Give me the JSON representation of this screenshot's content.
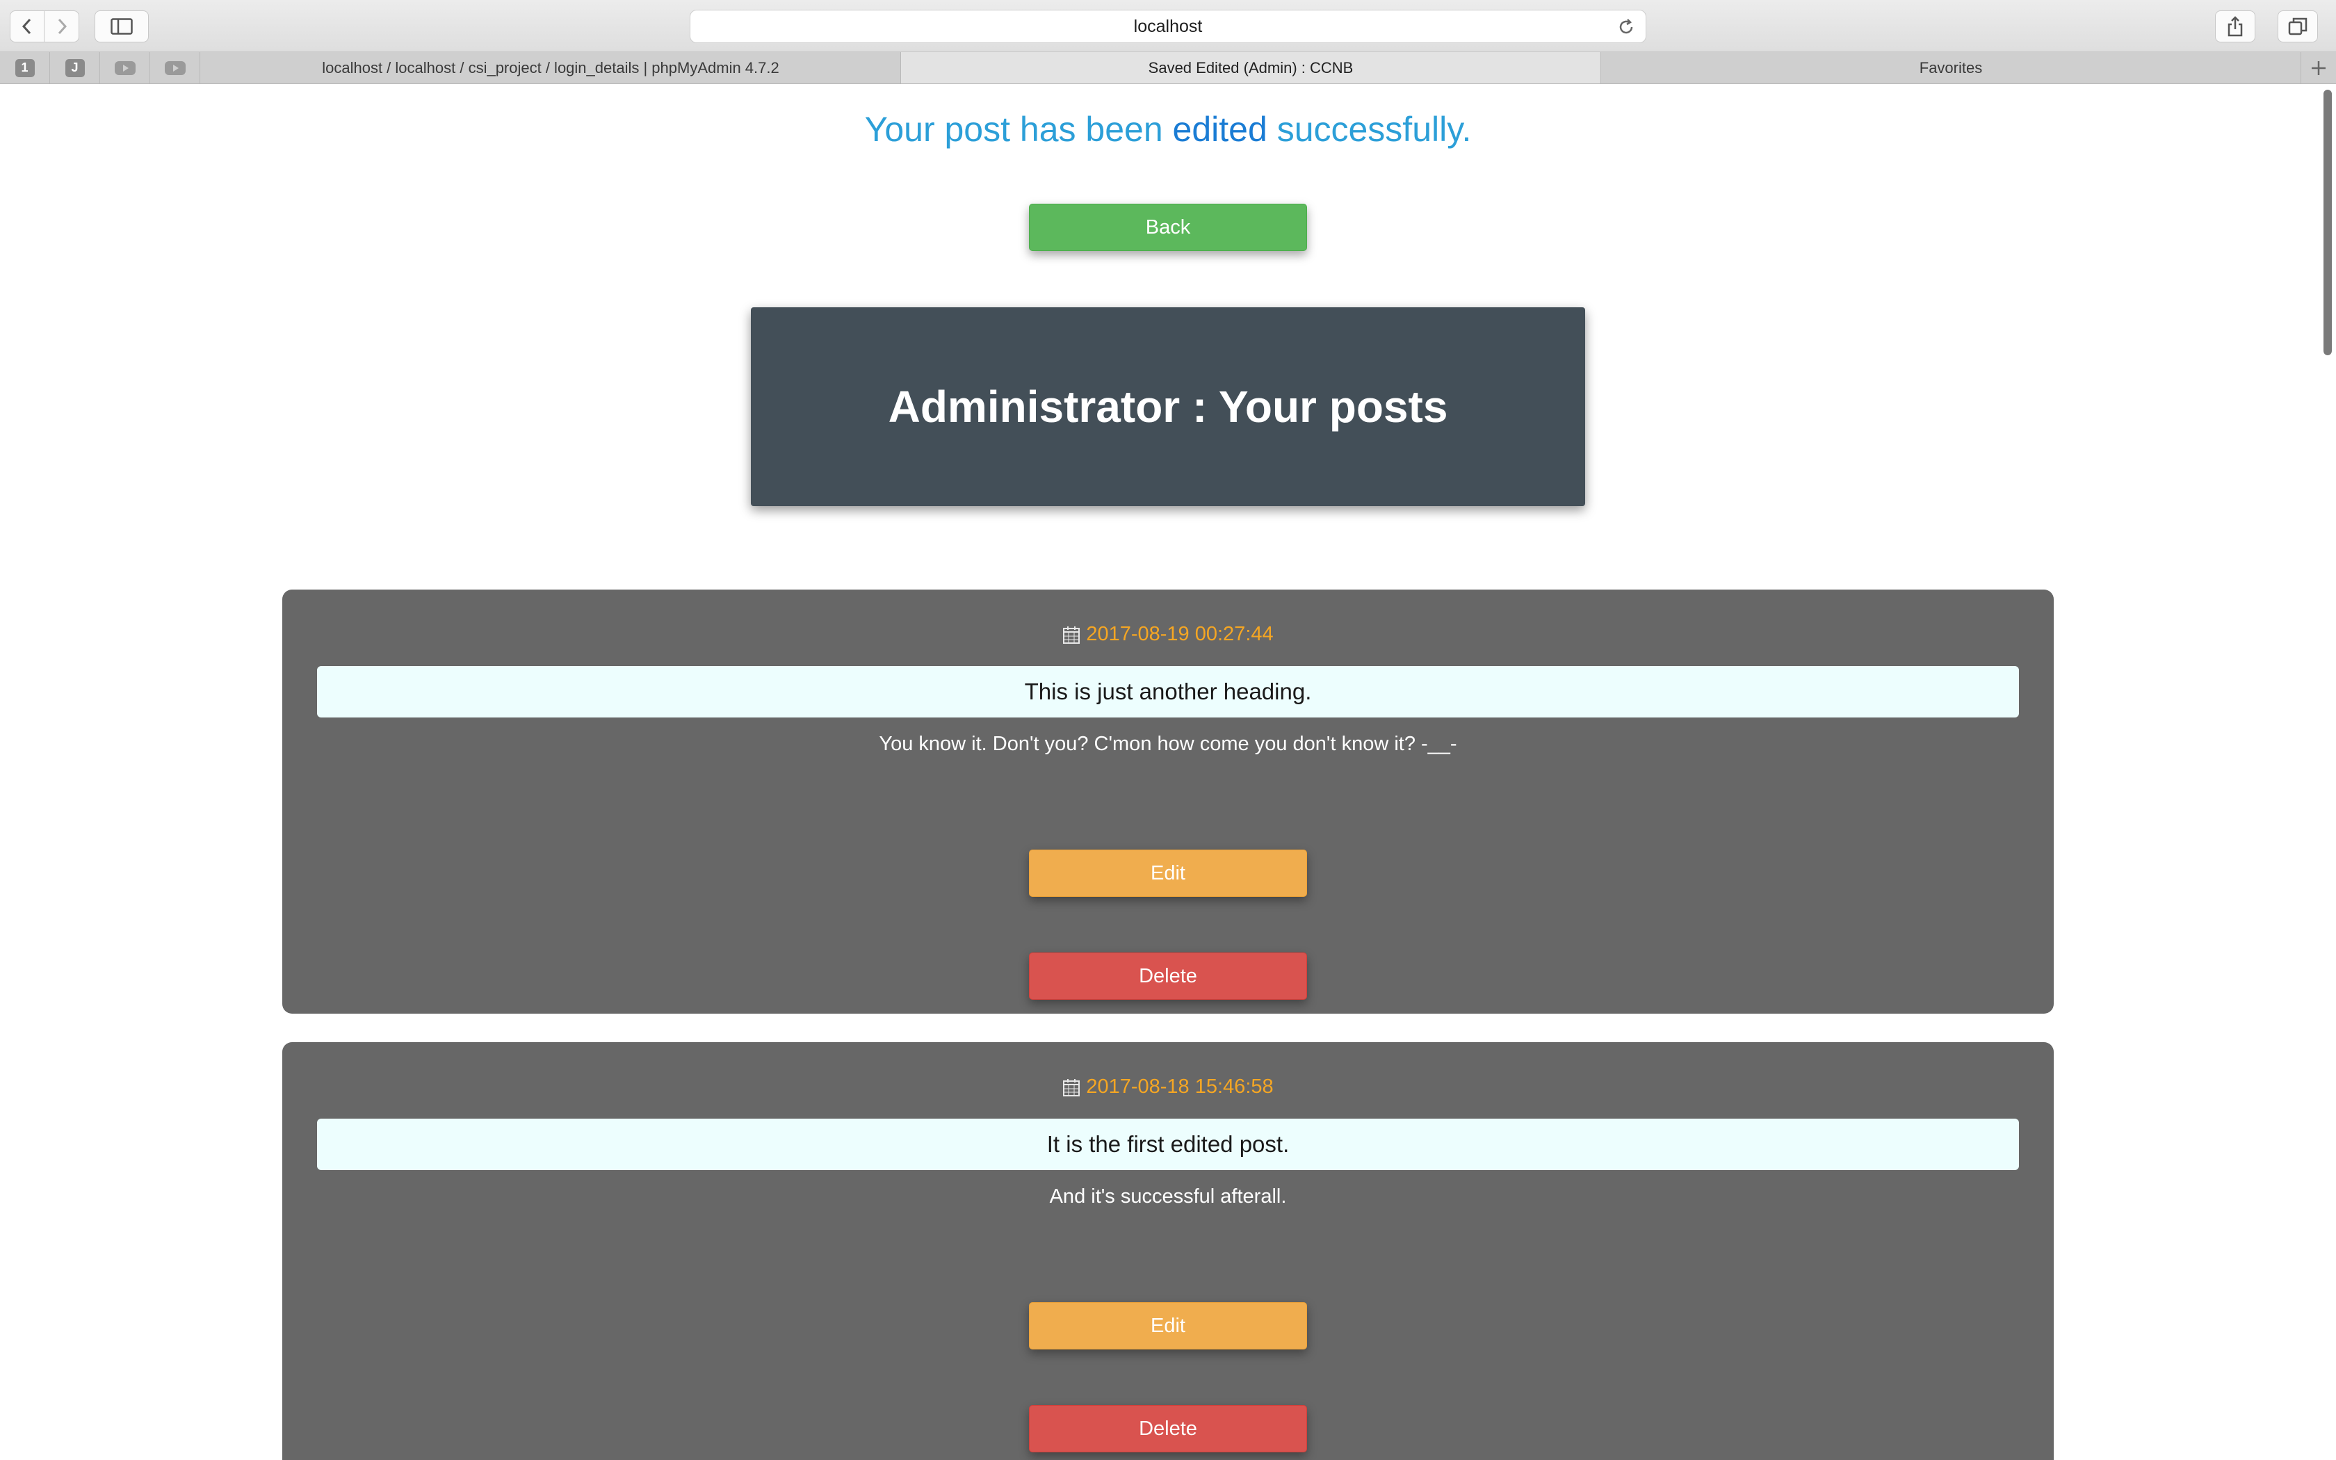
{
  "browser": {
    "address": "localhost",
    "pinned_tabs": [
      {
        "label": "1"
      },
      {
        "label": "J"
      }
    ],
    "tabs": [
      {
        "title": "localhost / localhost / csi_project / login_details | phpMyAdmin 4.7.2"
      },
      {
        "title": "Saved Edited (Admin) : CCNB"
      },
      {
        "title": "Favorites"
      }
    ]
  },
  "page": {
    "success_prefix": "Your post has been",
    "success_emphasis": "edited",
    "success_suffix": "successfully.",
    "back_label": "Back",
    "admin_title": "Administrator : Your posts"
  },
  "posts": [
    {
      "date": "2017-08-19 00:27:44",
      "heading": "This is just another heading.",
      "body": "You know it. Don't you? C'mon how come you don't know it? -__-",
      "edit_label": "Edit",
      "delete_label": "Delete"
    },
    {
      "date": "2017-08-18 15:46:58",
      "heading": "It is the first edited post.",
      "body": "And it's successful afterall.",
      "edit_label": "Edit",
      "delete_label": "Delete"
    }
  ],
  "colors": {
    "success_text": "#2c9fd8",
    "back_button": "#5cb85c",
    "admin_box": "#434f58",
    "post_card": "#676767",
    "date_text": "#f5a623",
    "edit_button": "#f0ad4e",
    "delete_button": "#d9534f"
  }
}
